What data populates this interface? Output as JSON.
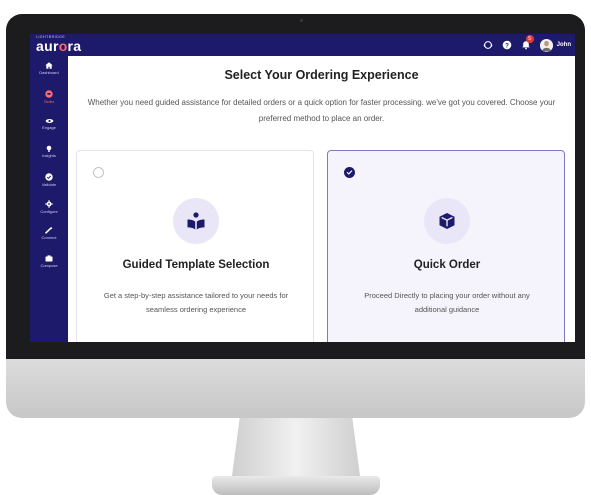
{
  "brand": {
    "sub": "LIGHTBRIDGE",
    "name_a": "aur",
    "name_o": "o",
    "name_b": "ra"
  },
  "header": {
    "notification_count": "5",
    "user_name": "John"
  },
  "sidebar": {
    "items": [
      {
        "label": "Dashboard",
        "icon": "home-icon"
      },
      {
        "label": "Order",
        "icon": "cart-icon"
      },
      {
        "label": "Engage",
        "icon": "engage-icon"
      },
      {
        "label": "Insights",
        "icon": "insights-icon"
      },
      {
        "label": "Validate",
        "icon": "check-icon"
      },
      {
        "label": "Configure",
        "icon": "gear-icon"
      },
      {
        "label": "Connect",
        "icon": "link-icon"
      },
      {
        "label": "Compose",
        "icon": "compose-icon"
      }
    ]
  },
  "main": {
    "title": "Select Your Ordering Experience",
    "subtitle": "Whether you need guided assistance for detailed orders or a quick option for faster processing. we've got you covered. Choose your preferred method to place an order."
  },
  "options": [
    {
      "title": "Guided Template Selection",
      "description": "Get a step-by-step assistance tailored to your needs for seamless ordering experience",
      "icon": "book-reader-icon",
      "selected": false
    },
    {
      "title": "Quick Order",
      "description": "Proceed Directly to placing your order without any additional guidance",
      "icon": "box-icon",
      "selected": true
    }
  ],
  "colors": {
    "brand_navy": "#1e1a6b",
    "accent_coral": "#ff6b6b",
    "selected_border": "#7e78c9"
  }
}
